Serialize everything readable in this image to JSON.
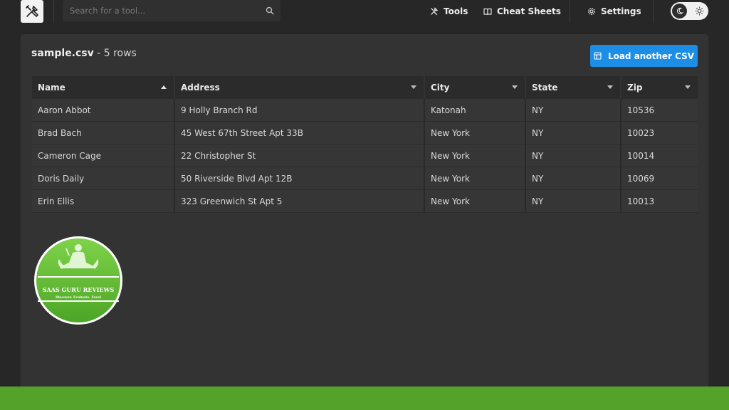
{
  "search": {
    "placeholder": "Search for a tool..."
  },
  "nav": {
    "tools": "Tools",
    "cheat_sheets": "Cheat Sheets",
    "settings": "Settings"
  },
  "file": {
    "name": "sample.csv",
    "rows_label": " - 5 rows"
  },
  "load_button": {
    "label": "Load another CSV"
  },
  "table": {
    "columns": [
      "Name",
      "Address",
      "City",
      "State",
      "Zip"
    ],
    "rows": [
      [
        "Aaron Abbot",
        "9 Holly Branch Rd",
        "Katonah",
        "NY",
        "10536"
      ],
      [
        "Brad Bach",
        "45 West 67th Street Apt 33B",
        "New York",
        "NY",
        "10023"
      ],
      [
        "Cameron Cage",
        "22 Christopher St",
        "New York",
        "NY",
        "10014"
      ],
      [
        "Doris Daily",
        "50 Riverside Blvd Apt 12B",
        "New York",
        "NY",
        "10069"
      ],
      [
        "Erin Ellis",
        "323 Greenwich St Apt 5",
        "New York",
        "NY",
        "10013"
      ]
    ]
  },
  "badge": {
    "title": "SAAS GURU REVIEWS",
    "tagline": "Discover. Evaluate. Excel"
  },
  "icons": {
    "logo": "tools-icon",
    "search": "search-icon",
    "theme_dark": "moon-icon",
    "theme_light": "sun-icon"
  },
  "colors": {
    "accent": "#1c8ee6",
    "footer": "#55a22b",
    "badge_green": "#6cc43a"
  }
}
